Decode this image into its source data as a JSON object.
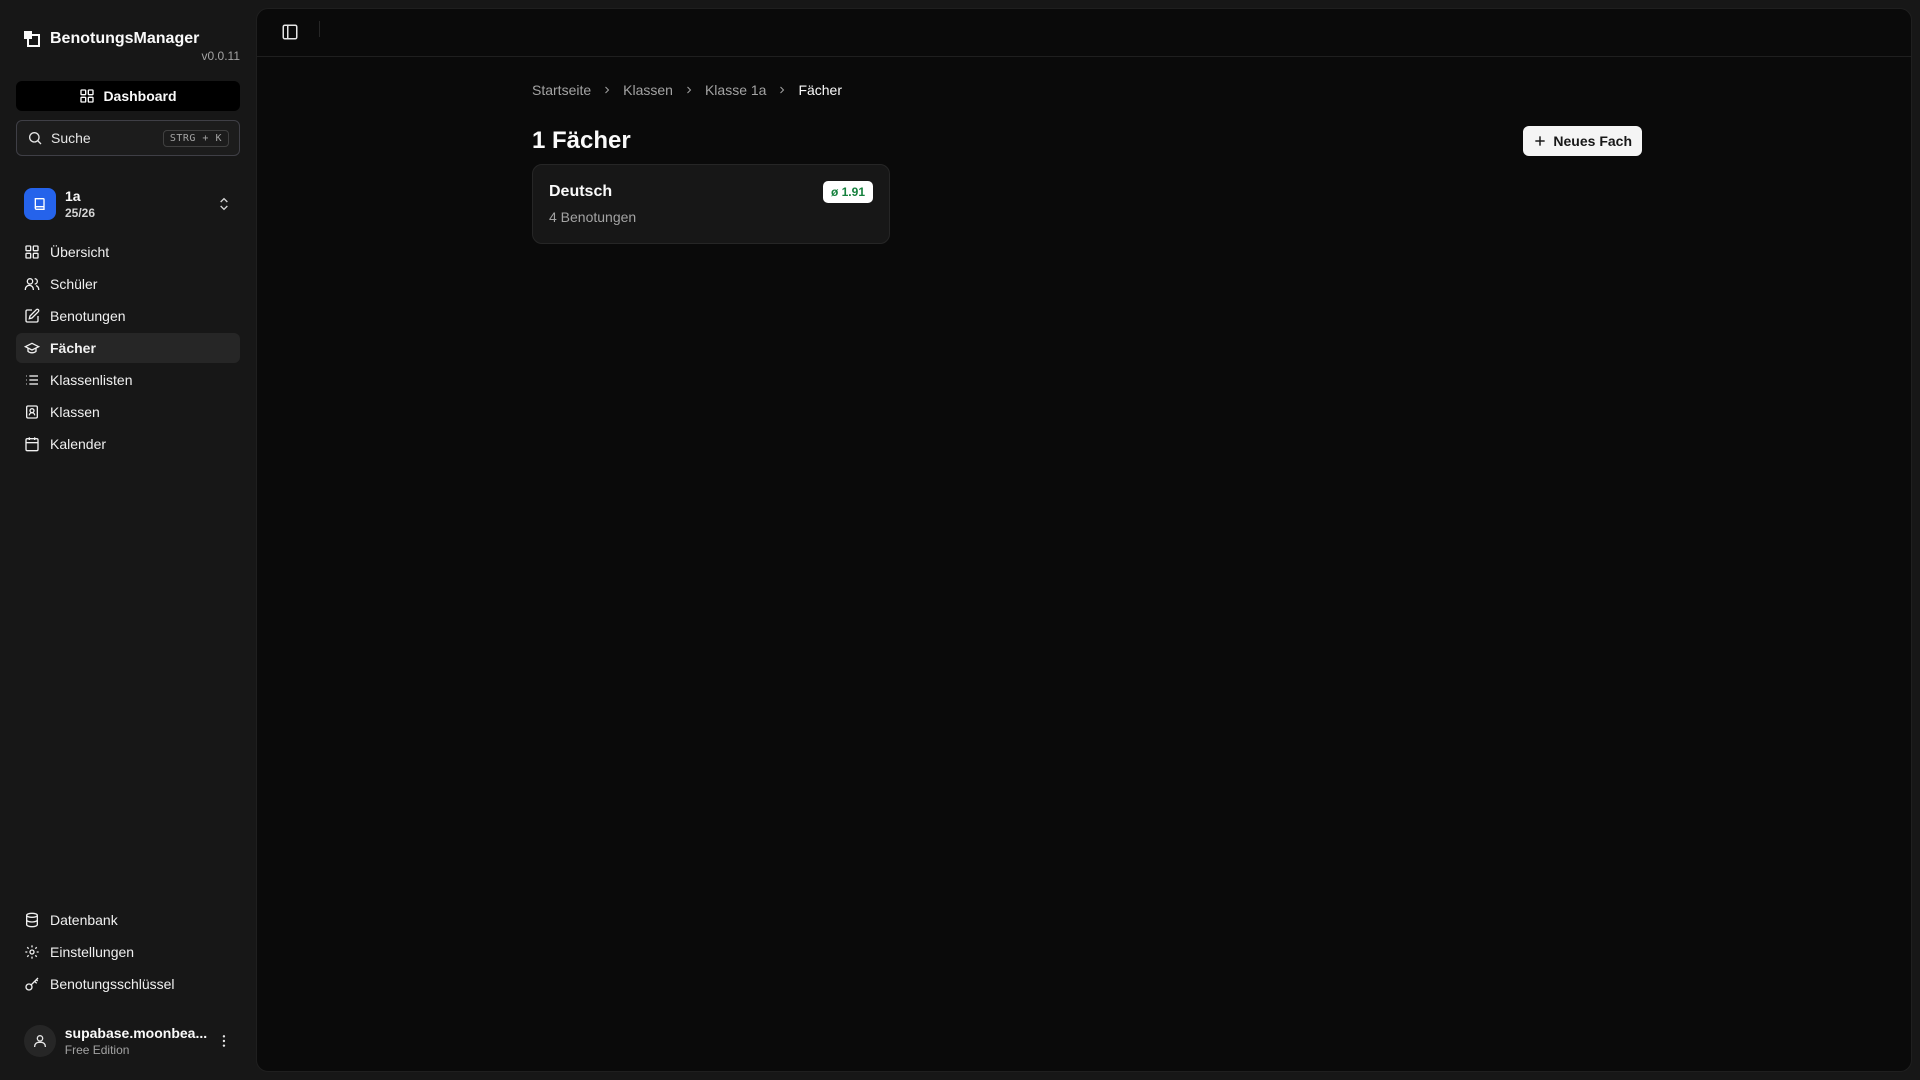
{
  "app": {
    "name": "BenotungsManager",
    "version": "v0.0.11"
  },
  "sidebar": {
    "dashboard_label": "Dashboard",
    "search": {
      "label": "Suche",
      "shortcut": "STRG + K"
    },
    "class_switcher": {
      "name": "1a",
      "year": "25/26"
    },
    "nav": [
      {
        "label": "Übersicht",
        "icon": "layout-grid-icon"
      },
      {
        "label": "Schüler",
        "icon": "users-icon"
      },
      {
        "label": "Benotungen",
        "icon": "edit-icon"
      },
      {
        "label": "Fächer",
        "icon": "graduation-cap-icon",
        "active": true
      },
      {
        "label": "Klassenlisten",
        "icon": "list-icon"
      },
      {
        "label": "Klassen",
        "icon": "contact-icon"
      },
      {
        "label": "Kalender",
        "icon": "calendar-icon"
      }
    ],
    "footer_nav": [
      {
        "label": "Datenbank",
        "icon": "database-icon"
      },
      {
        "label": "Einstellungen",
        "icon": "gear-icon"
      },
      {
        "label": "Benotungsschlüssel",
        "icon": "key-icon"
      }
    ],
    "user": {
      "name": "supabase.moonbea...",
      "plan": "Free Edition"
    }
  },
  "breadcrumb": [
    "Startseite",
    "Klassen",
    "Klasse 1a",
    "Fächer"
  ],
  "page": {
    "title": "1 Fächer",
    "new_button_label": "Neues Fach"
  },
  "subjects": [
    {
      "name": "Deutsch",
      "grade_count": "4 Benotungen",
      "average": "ø 1.91"
    }
  ],
  "colors": {
    "accent_blue": "#2563eb",
    "average_green": "#15803d",
    "background": "#0a0a0a"
  }
}
